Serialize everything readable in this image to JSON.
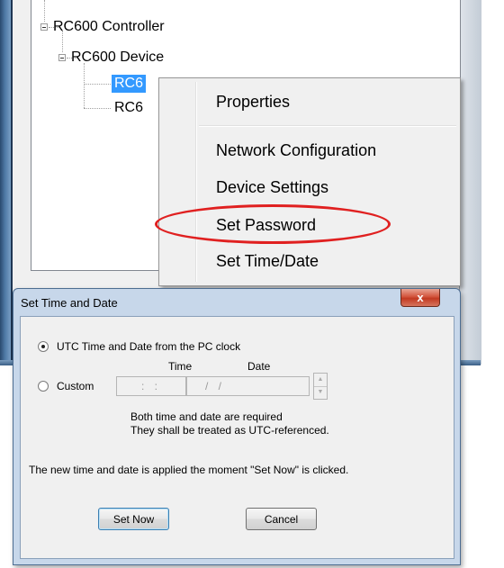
{
  "tree": {
    "nodes": [
      {
        "label": "RC600 Controller"
      },
      {
        "label": "RC600 Device"
      },
      {
        "label": "RC6"
      },
      {
        "label": "RC6"
      }
    ]
  },
  "context_menu": {
    "items": [
      "Properties",
      "Network Configuration",
      "Device Settings",
      "Set Password",
      "Set Time/Date"
    ],
    "highlight_color": "#e02020"
  },
  "dialog": {
    "title": "Set Time and Date",
    "close_glyph": "x",
    "utc_option_label": "UTC Time and Date from the PC clock",
    "custom_option_label": "Custom",
    "time_header": "Time",
    "date_header": "Date",
    "time_value": ":   :",
    "date_value": "/  /",
    "note_line1": "Both time and date are required",
    "note_line2": "They shall be treated as UTC-referenced.",
    "apply_note": "The new time and date is applied the moment  \"Set Now\" is clicked.",
    "set_now_label": "Set Now",
    "cancel_label": "Cancel",
    "selected_option": "utc"
  },
  "colors": {
    "selection": "#3399ff",
    "titlebar": "#c7d7ea",
    "close_button": "#c23a22"
  }
}
